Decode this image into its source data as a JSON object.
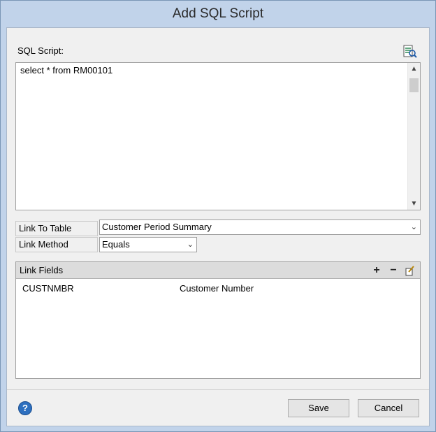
{
  "window": {
    "title": "Add SQL Script"
  },
  "sql": {
    "label": "SQL Script:",
    "text": "select * from RM00101",
    "find_icon": "find-in-document-icon"
  },
  "link_to_table": {
    "label": "Link To Table",
    "value": "Customer Period Summary"
  },
  "link_method": {
    "label": "Link Method",
    "value": "Equals"
  },
  "link_fields": {
    "header": "Link Fields",
    "add_icon": "+",
    "remove_icon": "−",
    "rows": [
      {
        "field": "CUSTNMBR",
        "description": "Customer Number"
      }
    ]
  },
  "footer": {
    "help_icon": "?",
    "save_label": "Save",
    "cancel_label": "Cancel"
  },
  "colors": {
    "title_bar": "#c1d3ea",
    "client": "#f0f0f0",
    "help_blue": "#2d6fbf"
  }
}
